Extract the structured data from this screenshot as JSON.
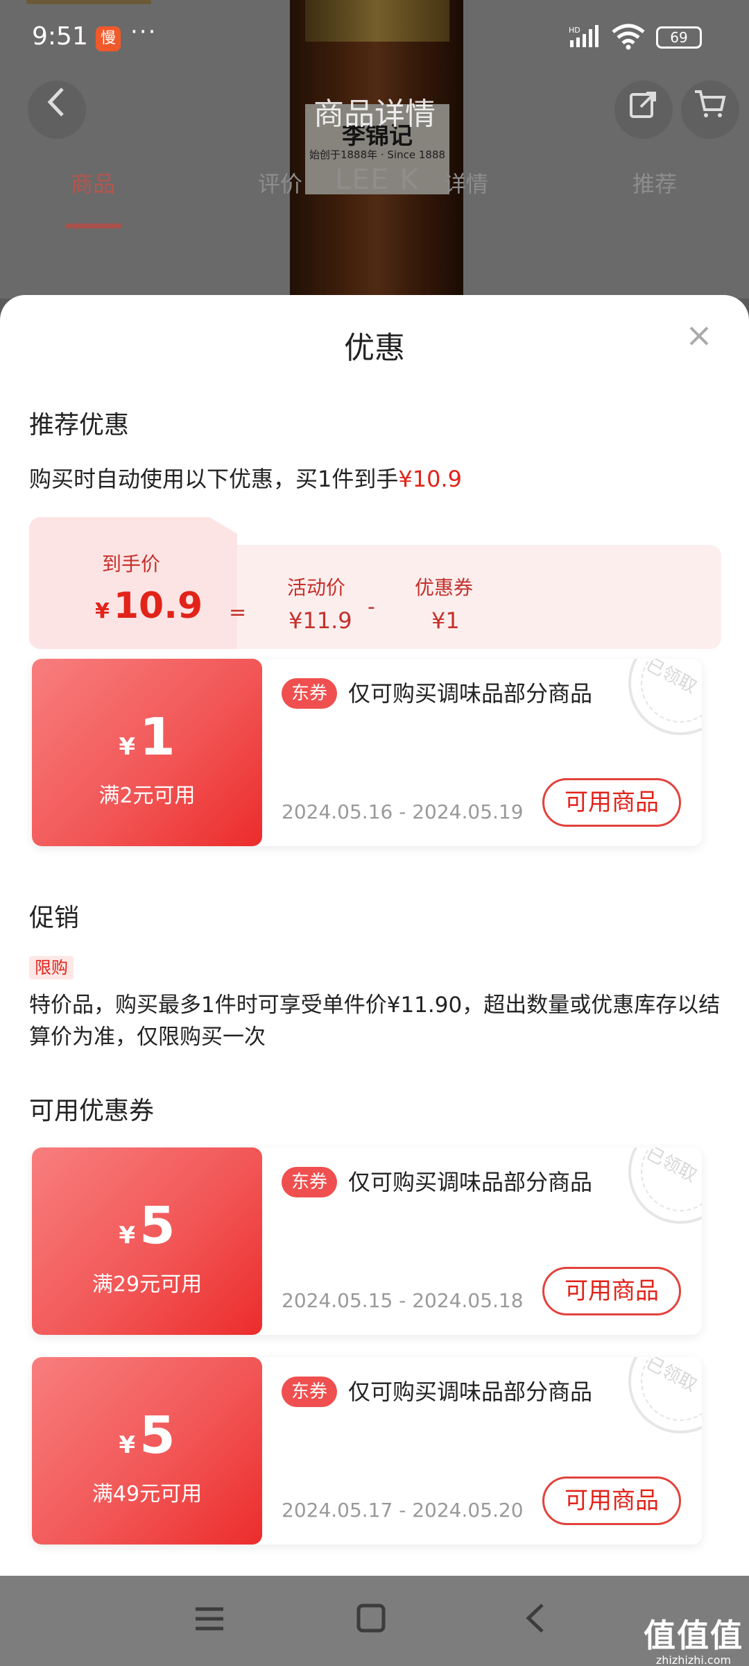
{
  "status": {
    "time": "9:51",
    "app_icon": "慢",
    "dots": "···",
    "signal": "HD",
    "battery": "69"
  },
  "header": {
    "title": "商品详情",
    "back_icon": "chevron-left-icon",
    "share_icon": "share-icon",
    "cart_icon": "cart-icon"
  },
  "background": {
    "brand": "李锦记",
    "since": "始创于1888年 · Since 1888",
    "brand_en": "LEE K"
  },
  "tabs": [
    {
      "label": "商品",
      "active": true
    },
    {
      "label": "评价",
      "active": false
    },
    {
      "label": "详情",
      "active": false
    },
    {
      "label": "推荐",
      "active": false
    }
  ],
  "sheet": {
    "title": "优惠",
    "close_icon": "close-icon",
    "recommended": {
      "title": "推荐优惠",
      "desc_prefix": "购买时自动使用以下优惠，买1件到手",
      "desc_price": "¥10.9",
      "final_label": "到手价",
      "final_currency": "¥",
      "final_price": "10.9",
      "equals": "=",
      "activity_label": "活动价",
      "activity_price": "¥11.9",
      "minus": "-",
      "coupon_label": "优惠券",
      "coupon_price": "¥1",
      "coupon": {
        "currency": "¥",
        "amount": "1",
        "condition": "满2元可用",
        "tag": "东券",
        "text": "仅可购买调味品部分商品",
        "dates": "2024.05.16 - 2024.05.19",
        "button": "可用商品",
        "stamp": "已领取"
      }
    },
    "promotion": {
      "title": "促销",
      "tag": "限购",
      "text": "特价品，购买最多1件时可享受单件价¥11.90，超出数量或优惠库存以结算价为准，仅限购买一次"
    },
    "available": {
      "title": "可用优惠券",
      "coupons": [
        {
          "currency": "¥",
          "amount": "5",
          "condition": "满29元可用",
          "tag": "东券",
          "text": "仅可购买调味品部分商品",
          "dates": "2024.05.15 - 2024.05.18",
          "button": "可用商品",
          "stamp": "已领取"
        },
        {
          "currency": "¥",
          "amount": "5",
          "condition": "满49元可用",
          "tag": "东券",
          "text": "仅可购买调味品部分商品",
          "dates": "2024.05.17 - 2024.05.20",
          "button": "可用商品",
          "stamp": "已领取"
        }
      ]
    }
  },
  "system_nav": {
    "menu_icon": "menu-icon",
    "home_icon": "home-icon",
    "back_icon": "back-icon"
  },
  "watermark": {
    "main": "值值值",
    "sub": "zhizhizhi.com"
  },
  "colors": {
    "accent": "#e2231a",
    "coupon_gradient_start": "#f87e7e",
    "coupon_gradient_end": "#ec2c2c"
  }
}
